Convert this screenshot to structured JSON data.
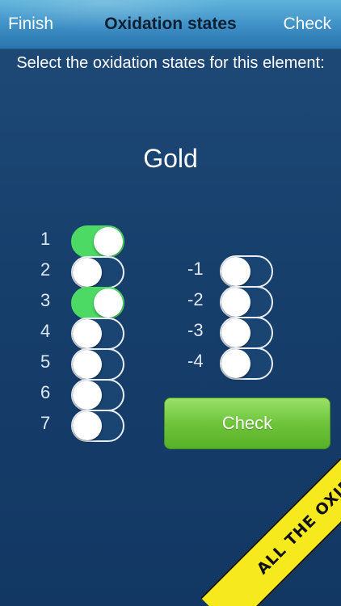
{
  "navbar": {
    "left_button": "Finish",
    "title": "Oxidation states",
    "right_button": "Check"
  },
  "prompt": "Select the oxidation states for this element:",
  "element": "Gold",
  "positive_states": [
    {
      "label": "1",
      "on": true
    },
    {
      "label": "2",
      "on": false
    },
    {
      "label": "3",
      "on": true
    },
    {
      "label": "4",
      "on": false
    },
    {
      "label": "5",
      "on": false
    },
    {
      "label": "6",
      "on": false
    },
    {
      "label": "7",
      "on": false
    }
  ],
  "negative_states": [
    {
      "label": "-1",
      "on": false
    },
    {
      "label": "-2",
      "on": false
    },
    {
      "label": "-3",
      "on": false
    },
    {
      "label": "-4",
      "on": false
    }
  ],
  "check_button": "Check",
  "banner": "ALL THE OXIDATION STATES",
  "colors": {
    "toggle_on": "#4cd964",
    "check_button": "#6ec53b",
    "banner": "#f6ea1e"
  }
}
